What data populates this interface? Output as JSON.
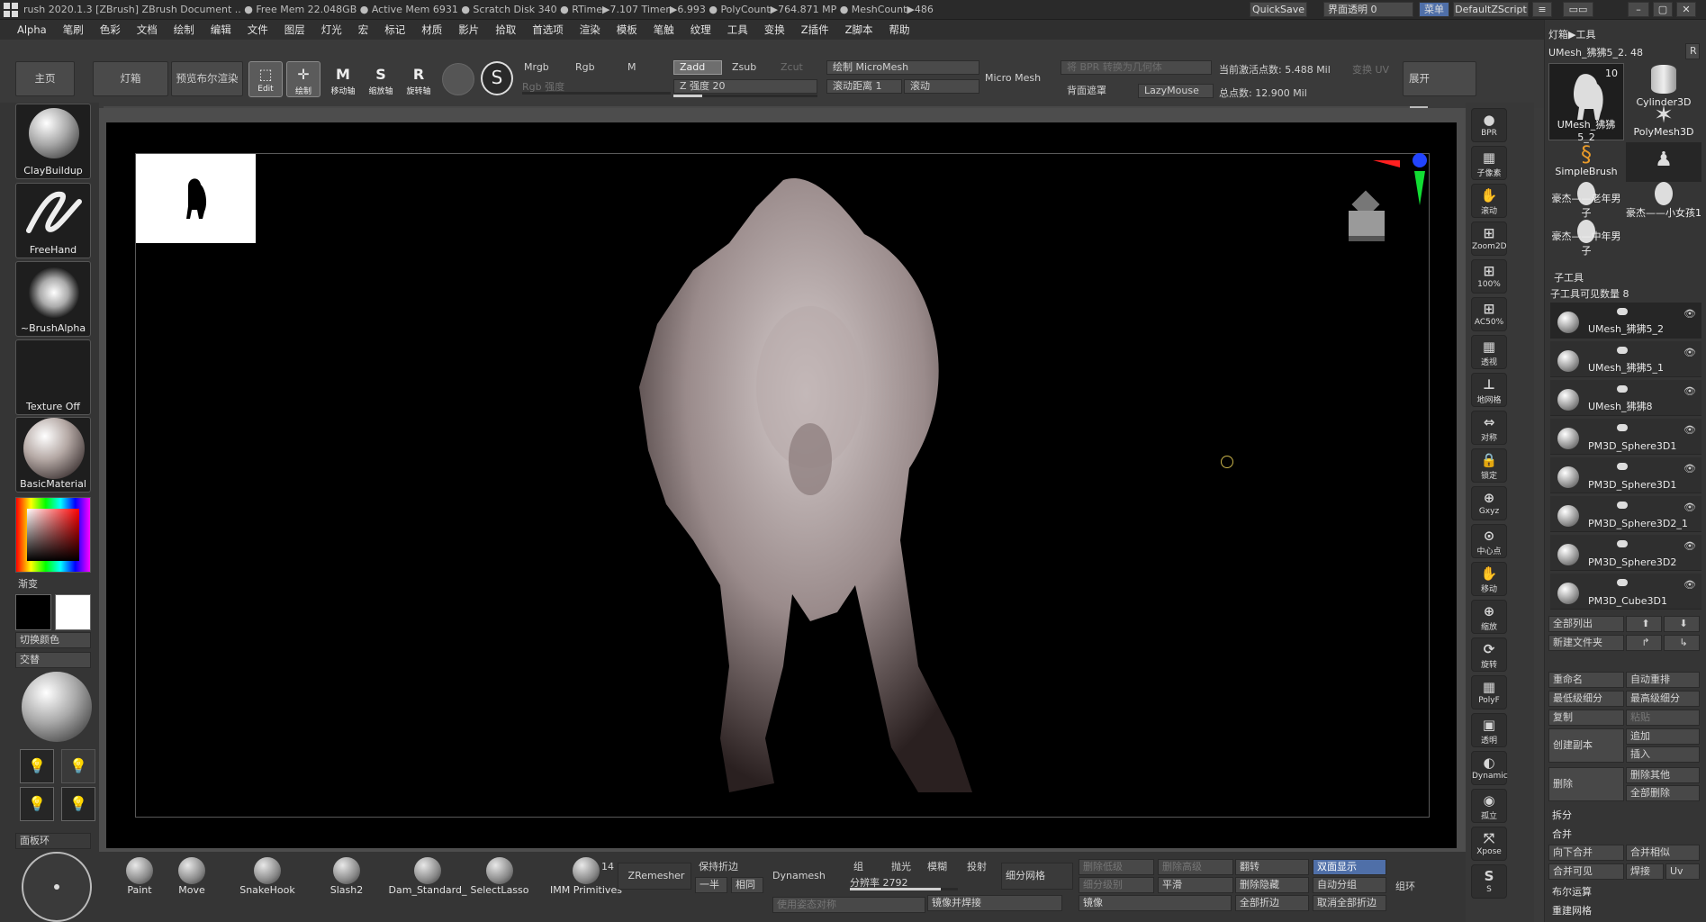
{
  "titlebar": {
    "text": "rush 2020.1.3 [ZBrush]  ZBrush Document   .. ● Free Mem 22.048GB ● Active Mem 6931 ● Scratch Disk 340 ● RTime▶7.107 Timer▶6.993 ● PolyCount▶764.871 MP ● MeshCount▶486",
    "quicksave": "QuickSave",
    "transparency": "界面透明 0",
    "menu": "菜单",
    "script": "DefaultZScript"
  },
  "menubar": [
    "Alpha",
    "笔刷",
    "色彩",
    "文档",
    "绘制",
    "编辑",
    "文件",
    "图层",
    "灯光",
    "宏",
    "标记",
    "材质",
    "影片",
    "拾取",
    "首选项",
    "渲染",
    "模板",
    "笔触",
    "纹理",
    "工具",
    "变换",
    "Z插件",
    "Z脚本",
    "帮助"
  ],
  "shelf": {
    "home": "主页",
    "lightbox": "灯箱",
    "bpr": "预览布尔渲染"
  },
  "tools": {
    "edit": "Edit",
    "draw": "绘制",
    "move": "移动轴",
    "scale": "缩放轴",
    "rotate": "旋转轴"
  },
  "draw_controls": {
    "mrgb": "Mrgb",
    "rgb": "Rgb",
    "m": "M",
    "rgb_intensity": "Rgb 强度",
    "zadd": "Zadd",
    "zsub": "Zsub",
    "zcut": "Zcut",
    "z_intensity": "Z 强度 20",
    "draw_micromesh": "绘制 MicroMesh",
    "scroll_distance": "滚动距离 1",
    "scroll": "滚动",
    "micromesh": "Micro Mesh",
    "bpr_to_geometry": "将 BPR 转换为几何体",
    "backface_mask": "背面遮罩",
    "lazymouse": "LazyMouse",
    "active_points": "当前激活点数: 5.488 Mil",
    "uv_transform": "变换 UV",
    "total_points": "总点数: 12.900 Mil",
    "expand": "展开"
  },
  "left": {
    "brush": "ClayBuildup",
    "stroke": "FreeHand",
    "alpha": "~BrushAlpha",
    "texture": "Texture Off",
    "material": "BasicMaterial",
    "gradient": "渐变",
    "switch_color": "切换颜色",
    "alternate": "交替",
    "tray": "面板环"
  },
  "right_strip": [
    "BPR",
    "子像素",
    "滚动",
    "Zoom2D",
    "100%",
    "AC50%",
    "透视",
    "地网格",
    "对称",
    "锁定",
    "Gxyz",
    "中心点",
    "移动",
    "缩放",
    "旋转",
    "PolyF",
    "透明",
    "Dynamic",
    "孤立",
    "Xpose",
    "S"
  ],
  "tool_panel": {
    "header": "灯箱▶工具",
    "current": "UMesh_狒狒5_2. 48",
    "r": "R",
    "meshes": [
      {
        "name": "UMesh_狒狒5_2",
        "count": "10"
      },
      {
        "name": "Cylinder3D"
      },
      {
        "name": "PolyMesh3D"
      },
      {
        "name": "SimpleBrush"
      },
      {
        "name": "豪杰——老年男子"
      },
      {
        "name": "豪杰——小女孩1"
      },
      {
        "name": "豪杰——中年男子"
      }
    ],
    "subtool_header": "子工具",
    "visible_count": "子工具可见数量 8",
    "subtools": [
      "UMesh_狒狒5_2",
      "UMesh_狒狒5_1",
      "UMesh_狒狒8",
      "PM3D_Sphere3D1",
      "PM3D_Sphere3D1",
      "PM3D_Sphere3D2_1",
      "PM3D_Sphere3D2",
      "PM3D_Cube3D1"
    ],
    "list_all": "全部列出",
    "new_folder": "新建文件夹",
    "rename": "重命名",
    "auto_reorder": "自动重排",
    "lowest_subdiv": "最低级细分",
    "highest_subdiv": "最高级细分",
    "copy": "复制",
    "paste": "粘贴",
    "duplicate": "创建副本",
    "append": "追加",
    "insert": "插入",
    "delete": "删除",
    "delete_other": "删除其他",
    "delete_all": "全部删除",
    "split": "拆分",
    "merge": "合并",
    "merge_down": "向下合并",
    "merge_similar": "合并相似",
    "merge_visible": "合并可见",
    "weld": "焊接",
    "uv": "Uv",
    "boolean": "布尔运算",
    "remesh": "重建网格"
  },
  "bottom": {
    "brushes": [
      "Paint",
      "Move",
      "SnakeHook",
      "Slash2",
      "Dam_Standard_",
      "SelectLasso",
      "IMM Primitives"
    ],
    "imm_count": "14",
    "zremesher": "ZRemesher",
    "keep_creases": "保持折边",
    "half": "一半",
    "same": "相同",
    "dynamesh": "Dynamesh",
    "group": "组",
    "polish": "抛光",
    "blur": "模糊",
    "project": "投射",
    "resolution": "分辨率 2792",
    "subdivide": "细分网格",
    "del_lower": "删除低级",
    "del_higher": "删除高级",
    "subdiv_level": "细分级别",
    "smooth": "平滑",
    "flip": "翻转",
    "double_sided": "双面显示",
    "delete_hidden": "删除隐藏",
    "auto_groups": "自动分组",
    "crease_all": "全部折边",
    "uncrease_all": "取消全部折边",
    "group_loops": "组环",
    "mirror_weld": "镜像并焊接",
    "mirror": "镜像",
    "use_poseable": "使用姿态对称"
  },
  "colors": {
    "accent_blue": "#4f6fa8",
    "background": "#3b3b3b",
    "viewport": "#000000"
  }
}
